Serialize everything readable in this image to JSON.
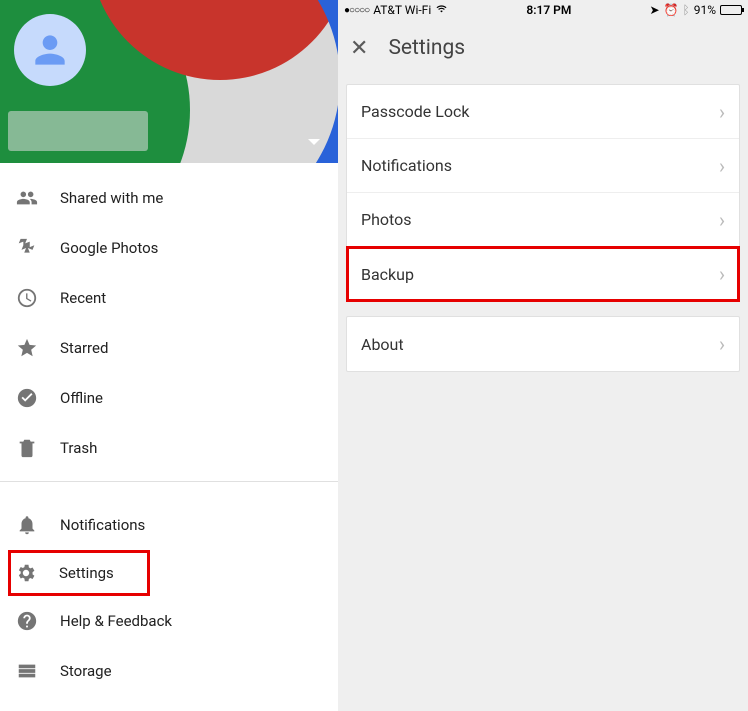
{
  "status_bar": {
    "carrier": "AT&T Wi-Fi",
    "time": "8:17 PM",
    "battery_pct": "91%"
  },
  "left_menu": {
    "items_top": [
      {
        "label": "Shared with me",
        "icon": "people"
      },
      {
        "label": "Google Photos",
        "icon": "gphotos"
      },
      {
        "label": "Recent",
        "icon": "clock"
      },
      {
        "label": "Starred",
        "icon": "star"
      },
      {
        "label": "Offline",
        "icon": "offline"
      },
      {
        "label": "Trash",
        "icon": "trash"
      }
    ],
    "items_bottom": [
      {
        "label": "Notifications",
        "icon": "bell"
      },
      {
        "label": "Settings",
        "icon": "gear",
        "highlight": true
      },
      {
        "label": "Help & Feedback",
        "icon": "help"
      },
      {
        "label": "Storage",
        "icon": "storage"
      }
    ]
  },
  "settings": {
    "title": "Settings",
    "groups": [
      [
        {
          "label": "Passcode Lock"
        },
        {
          "label": "Notifications"
        },
        {
          "label": "Photos"
        },
        {
          "label": "Backup",
          "highlight": true
        }
      ],
      [
        {
          "label": "About"
        }
      ]
    ]
  }
}
